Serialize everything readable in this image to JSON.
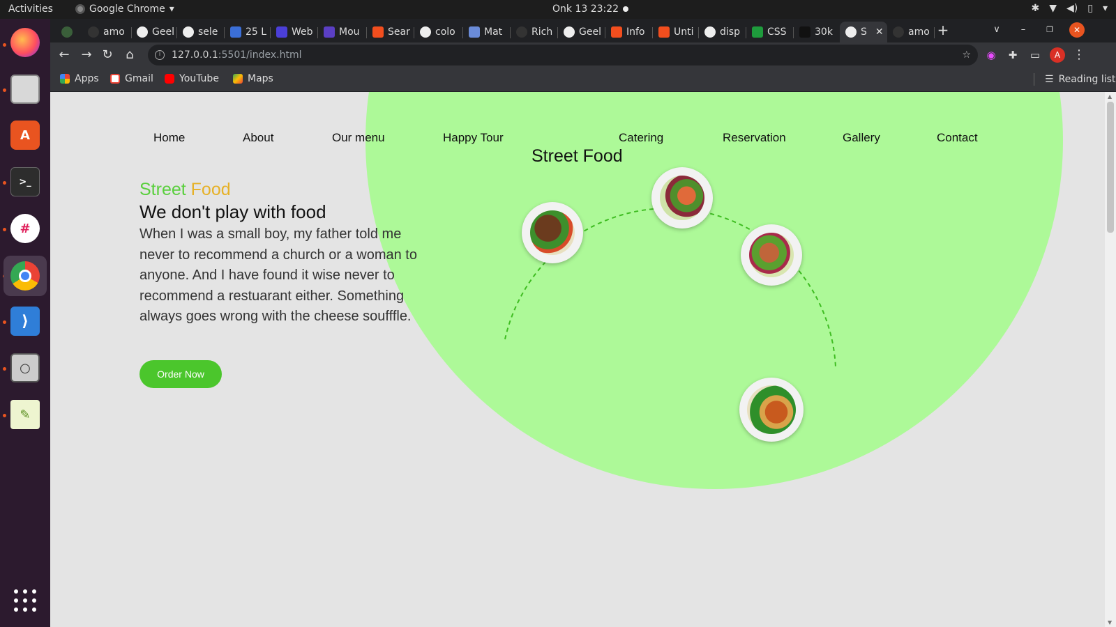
{
  "system": {
    "activities": "Activities",
    "app_menu": "Google Chrome",
    "clock": "Onk 13  23:22"
  },
  "tabs": [
    {
      "label": "amo"
    },
    {
      "label": "Geel"
    },
    {
      "label": "sele"
    },
    {
      "label": "25 L"
    },
    {
      "label": "Web"
    },
    {
      "label": "Mou"
    },
    {
      "label": "Sear"
    },
    {
      "label": "colo"
    },
    {
      "label": "Mat"
    },
    {
      "label": "Rich"
    },
    {
      "label": "Geel"
    },
    {
      "label": "Info"
    },
    {
      "label": "Unti"
    },
    {
      "label": "disp"
    },
    {
      "label": "CSS"
    },
    {
      "label": "30k"
    },
    {
      "label": "S",
      "active": true
    },
    {
      "label": "amo"
    }
  ],
  "toolbar": {
    "url_host": "127.0.0.1",
    "url_path": ":5501/index.html"
  },
  "bookmarks": [
    {
      "label": "Apps",
      "icon": "apps-grid-icon"
    },
    {
      "label": "Gmail",
      "icon": "gmail-icon"
    },
    {
      "label": "YouTube",
      "icon": "youtube-icon"
    },
    {
      "label": "Maps",
      "icon": "maps-icon"
    }
  ],
  "reading_list": "Reading list",
  "nav": [
    "Home",
    "About",
    "Our menu",
    "Happy Tour",
    "Catering",
    "Reservation",
    "Gallery",
    "Contact"
  ],
  "hero": {
    "section_title": "Street Food",
    "brand_green": "Street",
    "brand_orange": "Food",
    "tagline": "We don't play with food",
    "paragraph": "When I was a small boy, my father told me never to recommend a church or a woman to anyone. And I have found it wise never to recommend a restuarant either. Something always goes wrong with the cheese soufffle.",
    "button": "Order Now"
  },
  "colors": {
    "accent_green": "#59cf3c",
    "accent_orange": "#e6b127",
    "blob": "#adf998",
    "button": "#4bc62c"
  }
}
